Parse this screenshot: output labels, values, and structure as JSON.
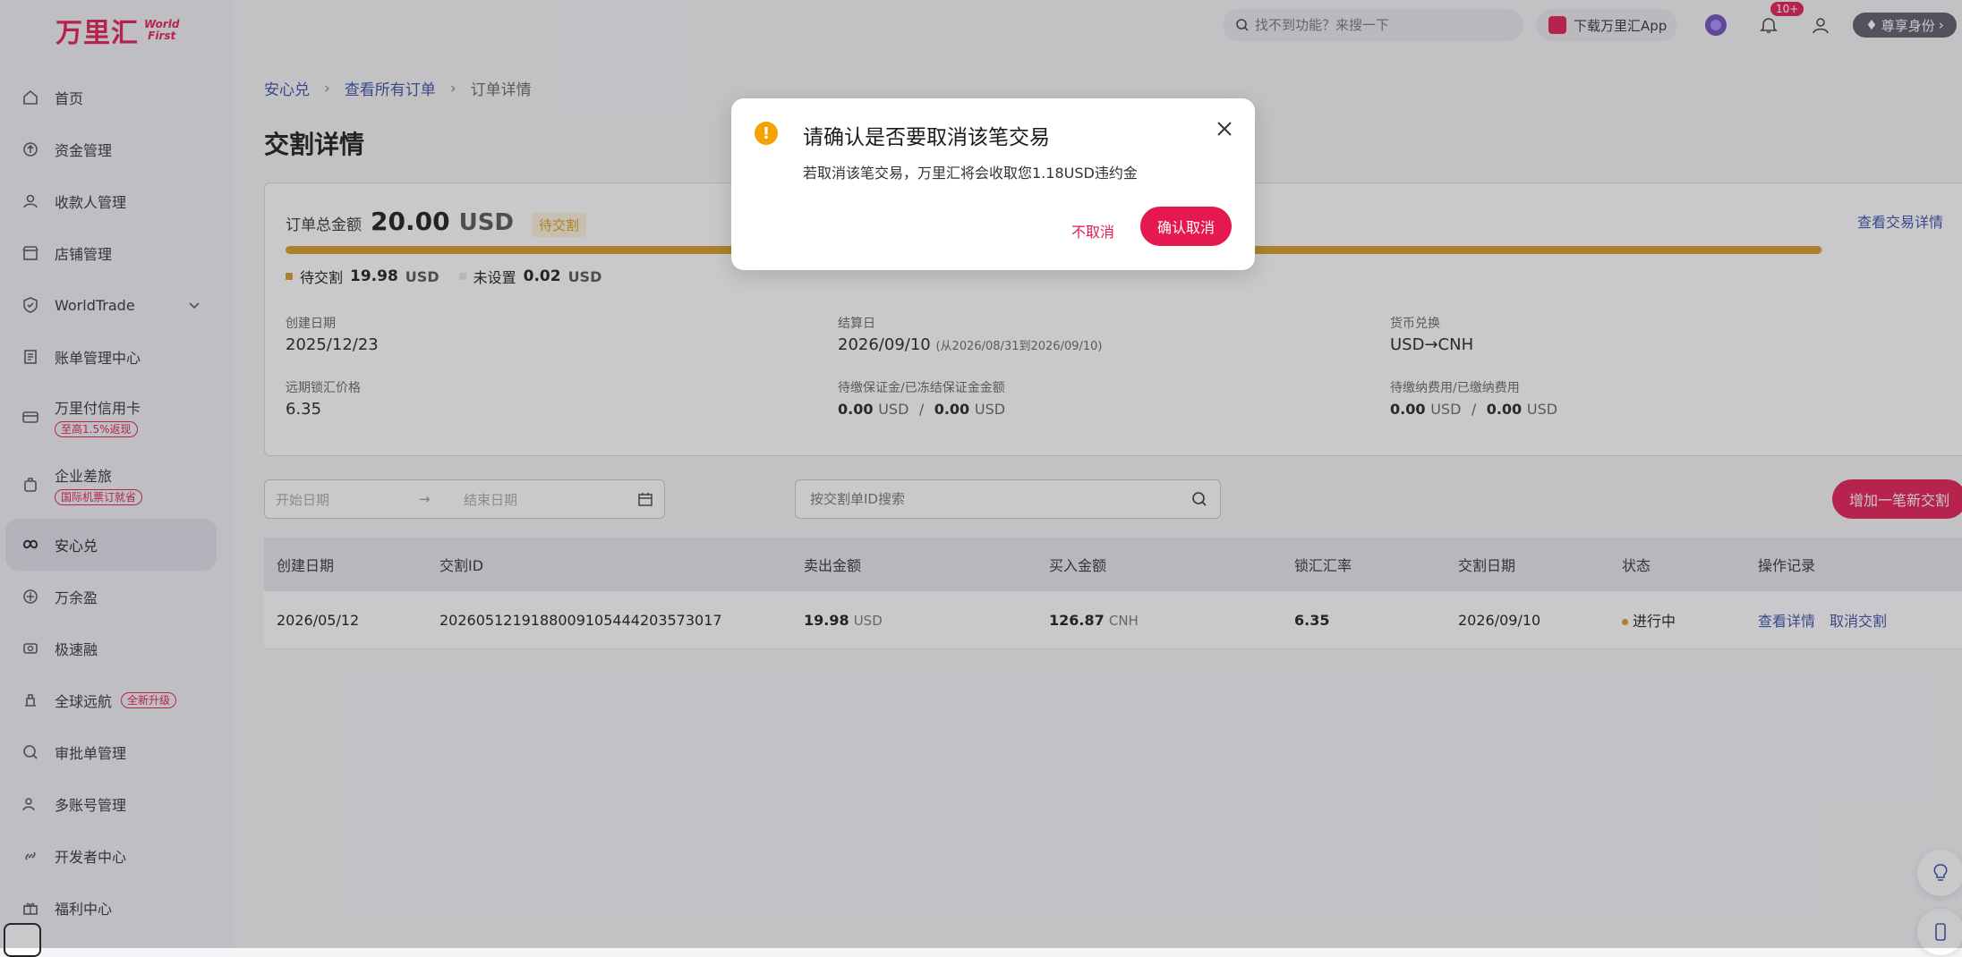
{
  "brand": {
    "cn": "万里汇",
    "en_line1": "World",
    "en_line2": "First",
    "color": "#e5194f"
  },
  "topbar": {
    "search_placeholder": "找不到功能？来搜一下",
    "download_app": "下载万里汇App",
    "notif_count": "10+",
    "vip_label": "尊享身份"
  },
  "sidebar": {
    "items": [
      {
        "label": "首页",
        "icon": "home-icon"
      },
      {
        "label": "资金管理",
        "icon": "funds-icon"
      },
      {
        "label": "收款人管理",
        "icon": "payee-icon"
      },
      {
        "label": "店铺管理",
        "icon": "store-icon"
      },
      {
        "label": "WorldTrade",
        "icon": "shield-icon",
        "expandable": true
      },
      {
        "label": "账单管理中心",
        "icon": "bill-icon"
      },
      {
        "label": "万里付信用卡",
        "icon": "card-icon",
        "badge": "至高1.5%返现"
      },
      {
        "label": "企业差旅",
        "icon": "travel-icon",
        "badge": "国际机票订就省"
      },
      {
        "label": "安心兑",
        "icon": "exchange-icon",
        "active": true
      },
      {
        "label": "万余盈",
        "icon": "yield-icon"
      },
      {
        "label": "极速融",
        "icon": "finance-icon"
      },
      {
        "label": "全球远航",
        "icon": "global-icon",
        "badge": "全新升级"
      },
      {
        "label": "审批单管理",
        "icon": "approval-icon"
      },
      {
        "label": "多账号管理",
        "icon": "accounts-icon"
      },
      {
        "label": "开发者中心",
        "icon": "developer-icon"
      },
      {
        "label": "福利中心",
        "icon": "gift-icon"
      }
    ]
  },
  "breadcrumb": {
    "c1": "安心兑",
    "c2": "查看所有订单",
    "c3": "订单详情"
  },
  "page_title": "交割详情",
  "order": {
    "total_label": "订单总金额",
    "total_amount": "20.00",
    "total_currency": "USD",
    "status_tag": "待交割",
    "view_trade": "查看交易详情",
    "progress_fraction": 0.999,
    "legend": {
      "pending_label": "待交割",
      "pending_amount": "19.98",
      "pending_unit": "USD",
      "unset_label": "未设置",
      "unset_amount": "0.02",
      "unset_unit": "USD"
    },
    "info": {
      "created_label": "创建日期",
      "created_value": "2025/12/23",
      "settle_label": "结算日",
      "settle_value": "2026/09/10",
      "settle_range": "(从2026/08/31到2026/09/10)",
      "fx_label": "货币兑换",
      "fx_value": "USD→CNH",
      "forward_label": "远期锁汇价格",
      "forward_value": "6.35",
      "margin_label": "待缴保证金/已冻结保证金金额",
      "margin_a": "0.00",
      "margin_a_unit": "USD",
      "margin_sep": "/",
      "margin_b": "0.00",
      "margin_b_unit": "USD",
      "fee_label": "待缴纳费用/已缴纳费用",
      "fee_a": "0.00",
      "fee_a_unit": "USD",
      "fee_sep": "/",
      "fee_b": "0.00",
      "fee_b_unit": "USD"
    }
  },
  "filters": {
    "start_placeholder": "开始日期",
    "arrow": "→",
    "end_placeholder": "结束日期",
    "id_search_placeholder": "按交割单ID搜索",
    "add_button": "增加一笔新交割"
  },
  "table": {
    "headers": [
      "创建日期",
      "交割ID",
      "卖出金额",
      "买入金额",
      "锁汇汇率",
      "交割日期",
      "状态",
      "操作记录"
    ],
    "rows": [
      {
        "created": "2026/05/12",
        "id": "20260512191880091054442035730​17",
        "sell_amount": "19.98",
        "sell_unit": "USD",
        "buy_amount": "126.87",
        "buy_unit": "CNH",
        "rate": "6.35",
        "date": "2026/09/10",
        "status": "进行中",
        "action_view": "查看详情",
        "action_cancel": "取消交割"
      }
    ]
  },
  "modal": {
    "title": "请确认是否要取消该笔交易",
    "body": "若取消该笔交易，万里汇将会收取您1.18USD违约金",
    "cancel_button": "不取消",
    "confirm_button": "确认取消"
  }
}
